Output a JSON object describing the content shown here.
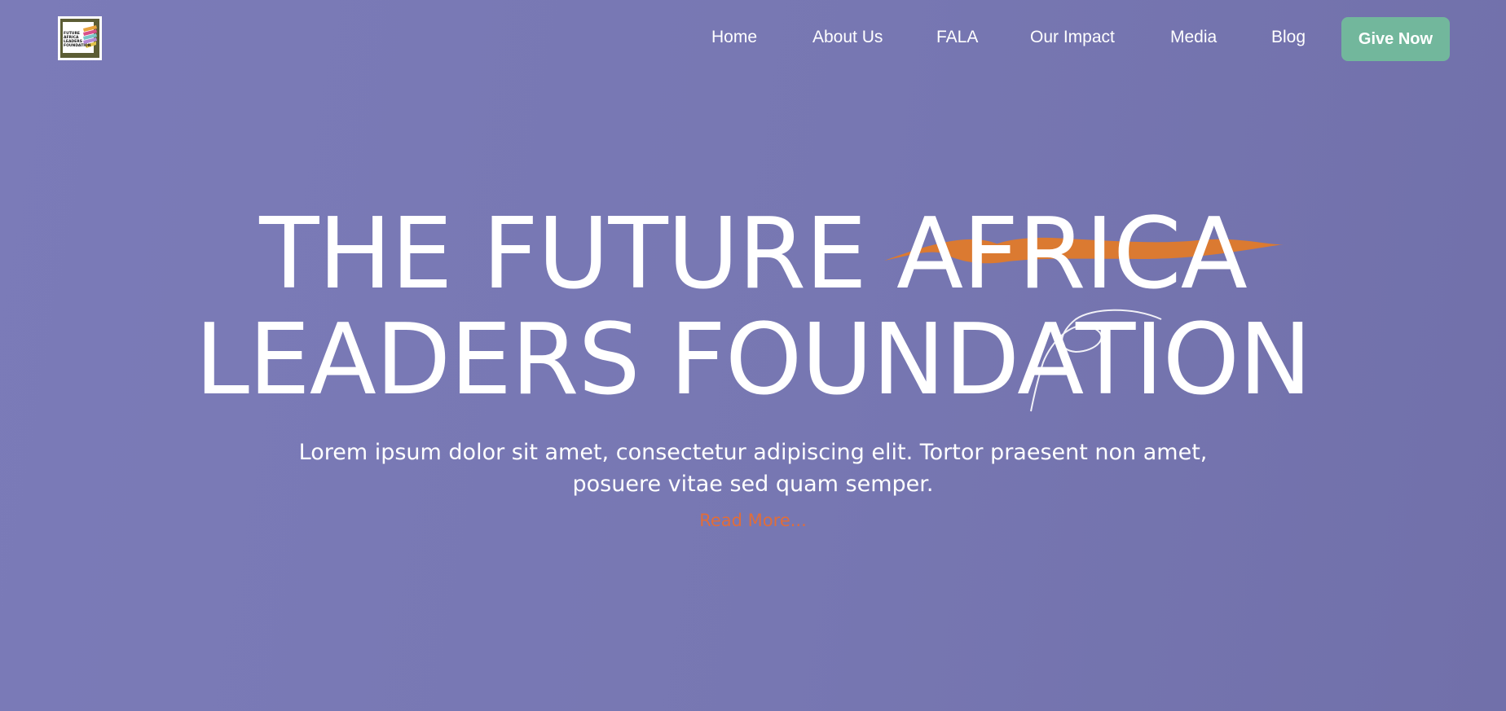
{
  "header": {
    "logo_text": "FUTURE\nAFRICA\nLEADERS\nFOUNDATION",
    "nav": [
      {
        "label": "Home"
      },
      {
        "label": "About Us"
      },
      {
        "label": "FALA"
      },
      {
        "label": "Our Impact"
      },
      {
        "label": "Media"
      },
      {
        "label": "Blog"
      }
    ],
    "cta_label": "Give Now"
  },
  "hero": {
    "title_line1": "THE FUTURE AFRICA",
    "title_line2": "LEADERS FOUNDATION",
    "subtitle": "Lorem ipsum dolor sit amet, consectetur adipiscing elit. Tortor praesent non amet, posuere vitae sed quam semper.",
    "read_more": "Read More..."
  },
  "colors": {
    "background": "#7777b2",
    "cta_background": "#72b79c",
    "accent_swoosh": "#e07a2a",
    "read_more": "#e06d3a",
    "text": "#ffffff"
  },
  "icons": [
    "logo-emblem",
    "orange-swoosh-decoration",
    "white-line-flourish"
  ]
}
